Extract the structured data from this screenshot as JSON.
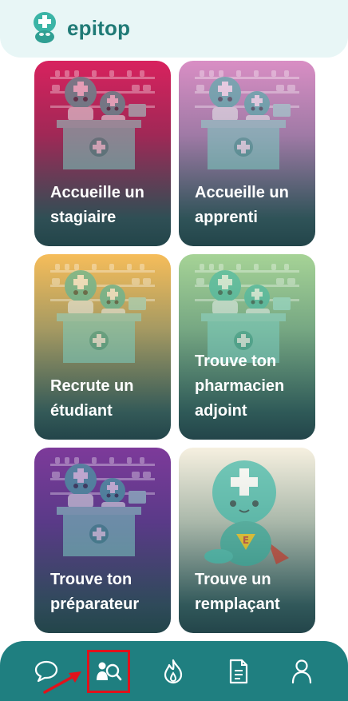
{
  "app": {
    "name": "epitop"
  },
  "cards": [
    {
      "label": "Accueille un stagiaire"
    },
    {
      "label": "Accueille un apprenti"
    },
    {
      "label": "Recrute un étudiant"
    },
    {
      "label": "Trouve ton pharmacien adjoint"
    },
    {
      "label": "Trouve ton préparateur"
    },
    {
      "label": "Trouve un remplaçant"
    }
  ],
  "nav": [
    {
      "icon": "chat-bubble-icon",
      "active": false
    },
    {
      "icon": "search-profile-icon",
      "active": true
    },
    {
      "icon": "flame-icon",
      "active": false
    },
    {
      "icon": "document-icon",
      "active": false
    },
    {
      "icon": "user-icon",
      "active": false
    }
  ],
  "colors": {
    "brand": "#1f7a76",
    "nav_bg": "#1f7f80",
    "highlight": "#e0121b"
  }
}
